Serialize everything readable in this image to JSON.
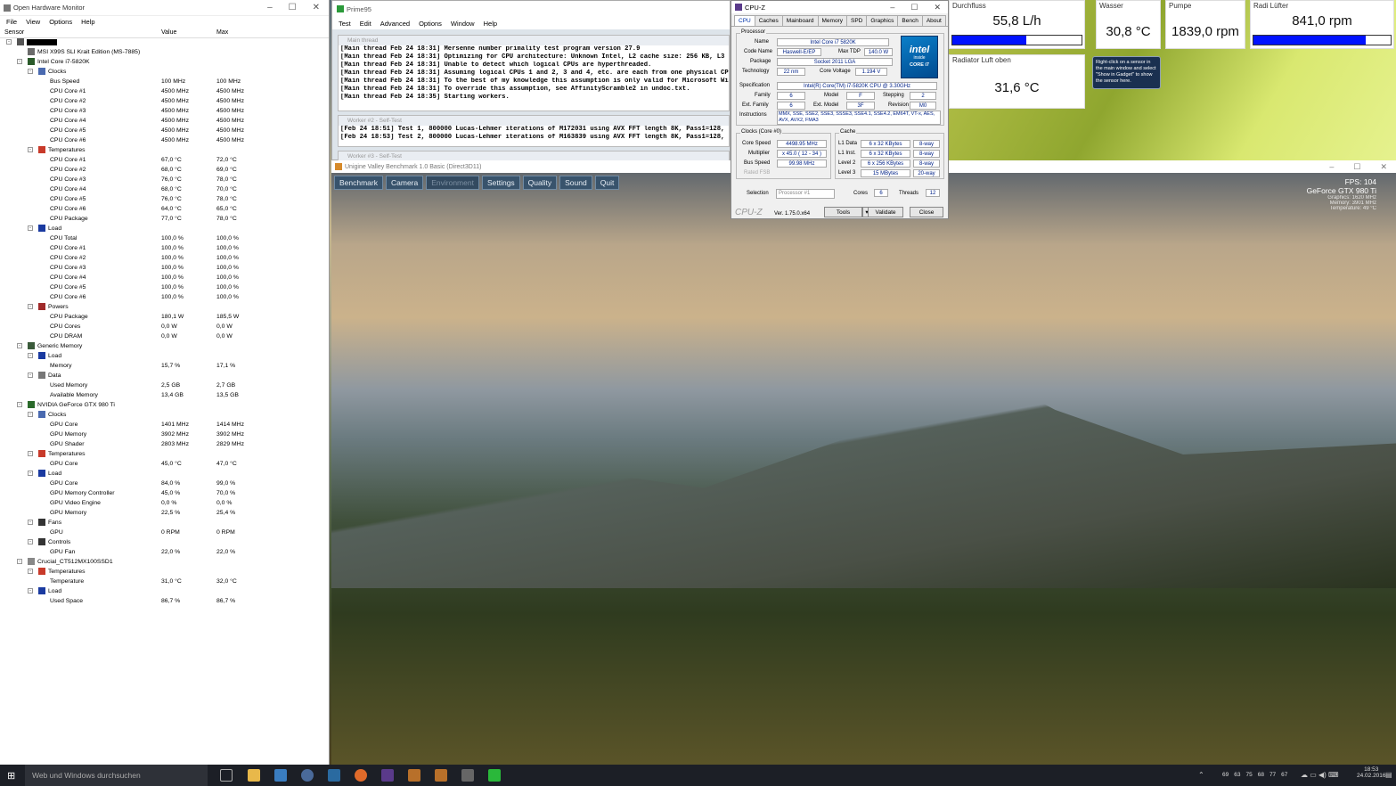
{
  "ohm": {
    "title": "Open Hardware Monitor",
    "menu": [
      "File",
      "View",
      "Options",
      "Help"
    ],
    "columns": [
      "Sensor",
      "Value",
      "Max"
    ],
    "rows": [
      {
        "level": 0,
        "name": "",
        "value": "",
        "max": "",
        "icon": "computer",
        "exp": "-",
        "redacted": true
      },
      {
        "level": 1,
        "name": "MSI X99S SLI Krait Edition (MS-7885)",
        "value": "",
        "max": "",
        "icon": "board"
      },
      {
        "level": 1,
        "name": "Intel Core i7-5820K",
        "value": "",
        "max": "",
        "icon": "cpu",
        "exp": "-"
      },
      {
        "level": 2,
        "name": "Clocks",
        "value": "",
        "max": "",
        "icon": "clock",
        "exp": "-"
      },
      {
        "level": 3,
        "name": "Bus Speed",
        "value": "100 MHz",
        "max": "100 MHz"
      },
      {
        "level": 3,
        "name": "CPU Core #1",
        "value": "4500 MHz",
        "max": "4500 MHz"
      },
      {
        "level": 3,
        "name": "CPU Core #2",
        "value": "4500 MHz",
        "max": "4500 MHz"
      },
      {
        "level": 3,
        "name": "CPU Core #3",
        "value": "4500 MHz",
        "max": "4500 MHz"
      },
      {
        "level": 3,
        "name": "CPU Core #4",
        "value": "4500 MHz",
        "max": "4500 MHz"
      },
      {
        "level": 3,
        "name": "CPU Core #5",
        "value": "4500 MHz",
        "max": "4500 MHz"
      },
      {
        "level": 3,
        "name": "CPU Core #6",
        "value": "4500 MHz",
        "max": "4500 MHz"
      },
      {
        "level": 2,
        "name": "Temperatures",
        "value": "",
        "max": "",
        "icon": "temp",
        "exp": "-"
      },
      {
        "level": 3,
        "name": "CPU Core #1",
        "value": "67,0 °C",
        "max": "72,0 °C"
      },
      {
        "level": 3,
        "name": "CPU Core #2",
        "value": "68,0 °C",
        "max": "69,0 °C"
      },
      {
        "level": 3,
        "name": "CPU Core #3",
        "value": "76,0 °C",
        "max": "78,0 °C"
      },
      {
        "level": 3,
        "name": "CPU Core #4",
        "value": "68,0 °C",
        "max": "70,0 °C"
      },
      {
        "level": 3,
        "name": "CPU Core #5",
        "value": "76,0 °C",
        "max": "78,0 °C"
      },
      {
        "level": 3,
        "name": "CPU Core #6",
        "value": "64,0 °C",
        "max": "65,0 °C"
      },
      {
        "level": 3,
        "name": "CPU Package",
        "value": "77,0 °C",
        "max": "78,0 °C"
      },
      {
        "level": 2,
        "name": "Load",
        "value": "",
        "max": "",
        "icon": "load",
        "exp": "-"
      },
      {
        "level": 3,
        "name": "CPU Total",
        "value": "100,0 %",
        "max": "100,0 %"
      },
      {
        "level": 3,
        "name": "CPU Core #1",
        "value": "100,0 %",
        "max": "100,0 %"
      },
      {
        "level": 3,
        "name": "CPU Core #2",
        "value": "100,0 %",
        "max": "100,0 %"
      },
      {
        "level": 3,
        "name": "CPU Core #3",
        "value": "100,0 %",
        "max": "100,0 %"
      },
      {
        "level": 3,
        "name": "CPU Core #4",
        "value": "100,0 %",
        "max": "100,0 %"
      },
      {
        "level": 3,
        "name": "CPU Core #5",
        "value": "100,0 %",
        "max": "100,0 %"
      },
      {
        "level": 3,
        "name": "CPU Core #6",
        "value": "100,0 %",
        "max": "100,0 %"
      },
      {
        "level": 2,
        "name": "Powers",
        "value": "",
        "max": "",
        "icon": "power",
        "exp": "-"
      },
      {
        "level": 3,
        "name": "CPU Package",
        "value": "180,1 W",
        "max": "185,5 W"
      },
      {
        "level": 3,
        "name": "CPU Cores",
        "value": "0,0 W",
        "max": "0,0 W"
      },
      {
        "level": 3,
        "name": "CPU DRAM",
        "value": "0,0 W",
        "max": "0,0 W"
      },
      {
        "level": 1,
        "name": "Generic Memory",
        "value": "",
        "max": "",
        "icon": "ram",
        "exp": "-"
      },
      {
        "level": 2,
        "name": "Load",
        "value": "",
        "max": "",
        "icon": "load",
        "exp": "-"
      },
      {
        "level": 3,
        "name": "Memory",
        "value": "15,7 %",
        "max": "17,1 %"
      },
      {
        "level": 2,
        "name": "Data",
        "value": "",
        "max": "",
        "icon": "data",
        "exp": "-"
      },
      {
        "level": 3,
        "name": "Used Memory",
        "value": "2,5 GB",
        "max": "2,7 GB"
      },
      {
        "level": 3,
        "name": "Available Memory",
        "value": "13,4 GB",
        "max": "13,5 GB"
      },
      {
        "level": 1,
        "name": "NVIDIA GeForce GTX 980 Ti",
        "value": "",
        "max": "",
        "icon": "gpu",
        "exp": "-"
      },
      {
        "level": 2,
        "name": "Clocks",
        "value": "",
        "max": "",
        "icon": "clock",
        "exp": "-"
      },
      {
        "level": 3,
        "name": "GPU Core",
        "value": "1401 MHz",
        "max": "1414 MHz"
      },
      {
        "level": 3,
        "name": "GPU Memory",
        "value": "3902 MHz",
        "max": "3902 MHz"
      },
      {
        "level": 3,
        "name": "GPU Shader",
        "value": "2803 MHz",
        "max": "2829 MHz"
      },
      {
        "level": 2,
        "name": "Temperatures",
        "value": "",
        "max": "",
        "icon": "temp",
        "exp": "-"
      },
      {
        "level": 3,
        "name": "GPU Core",
        "value": "45,0 °C",
        "max": "47,0 °C"
      },
      {
        "level": 2,
        "name": "Load",
        "value": "",
        "max": "",
        "icon": "load",
        "exp": "-"
      },
      {
        "level": 3,
        "name": "GPU Core",
        "value": "84,0 %",
        "max": "99,0 %"
      },
      {
        "level": 3,
        "name": "GPU Memory Controller",
        "value": "45,0 %",
        "max": "70,0 %"
      },
      {
        "level": 3,
        "name": "GPU Video Engine",
        "value": "0,0 %",
        "max": "0,0 %"
      },
      {
        "level": 3,
        "name": "GPU Memory",
        "value": "22,5 %",
        "max": "25,4 %"
      },
      {
        "level": 2,
        "name": "Fans",
        "value": "",
        "max": "",
        "icon": "fan",
        "exp": "-"
      },
      {
        "level": 3,
        "name": "GPU",
        "value": "0 RPM",
        "max": "0 RPM"
      },
      {
        "level": 2,
        "name": "Controls",
        "value": "",
        "max": "",
        "icon": "control",
        "exp": "-"
      },
      {
        "level": 3,
        "name": "GPU Fan",
        "value": "22,0 %",
        "max": "22,0 %"
      },
      {
        "level": 1,
        "name": "Crucial_CT512MX100SSD1",
        "value": "",
        "max": "",
        "icon": "disk",
        "exp": "-"
      },
      {
        "level": 2,
        "name": "Temperatures",
        "value": "",
        "max": "",
        "icon": "temp",
        "exp": "-"
      },
      {
        "level": 3,
        "name": "Temperature",
        "value": "31,0 °C",
        "max": "32,0 °C"
      },
      {
        "level": 2,
        "name": "Load",
        "value": "",
        "max": "",
        "icon": "load",
        "exp": "-"
      },
      {
        "level": 3,
        "name": "Used Space",
        "value": "86,7 %",
        "max": "86,7 %"
      }
    ]
  },
  "prime95": {
    "title": "Prime95",
    "menu": [
      "Test",
      "Edit",
      "Advanced",
      "Options",
      "Window",
      "Help"
    ],
    "main_title": "Main thread",
    "main_lines": [
      "[Main thread Feb 24 18:31] Mersenne number primality test program version 27.9",
      "[Main thread Feb 24 18:31] Optimizing for CPU architecture: Unknown Intel, L2 cache size: 256 KB, L3 cache siz",
      "[Main thread Feb 24 18:31] Unable to detect which logical CPUs are hyperthreaded.",
      "[Main thread Feb 24 18:31] Assuming logical CPUs 1 and 2, 3 and 4, etc. are each from one physical CPU core.",
      "[Main thread Feb 24 18:31] To the best of my knowledge this assumption is only valid for Microsoft Windows.",
      "[Main thread Feb 24 18:31] To override this assumption, see AffinityScramble2 in undoc.txt.",
      "[Main thread Feb 24 18:35] Starting workers."
    ],
    "worker_title": "Worker #2 - Self-Test",
    "worker_lines": [
      "[Feb 24 18:51] Test 1, 800000 Lucas-Lehmer iterations of M172031 using AVX FFT length 8K, Pass1=128, Pass",
      "[Feb 24 18:53] Test 2, 800000 Lucas-Lehmer iterations of M163839 using AVX FFT length 8K, Pass1=128, Pass"
    ],
    "worker3_title": "Worker #3 - Self-Test"
  },
  "cpuz": {
    "title": "CPU-Z",
    "tabs": [
      "CPU",
      "Caches",
      "Mainboard",
      "Memory",
      "SPD",
      "Graphics",
      "Bench",
      "About"
    ],
    "processor_label": "Processor",
    "name_label": "Name",
    "name": "Intel Core i7 5820K",
    "codename_label": "Code Name",
    "codename": "Haswell-E/EP",
    "maxtdp_label": "Max TDP",
    "maxtdp": "140.0 W",
    "package_label": "Package",
    "package": "Socket 2011 LGA",
    "tech_label": "Technology",
    "tech": "22 nm",
    "voltage_label": "Core Voltage",
    "voltage": "1.194 V",
    "spec_label": "Specification",
    "spec": "Intel(R) Core(TM) i7-5820K CPU @ 3.30GHz",
    "family_label": "Family",
    "family": "6",
    "model_label": "Model",
    "model": "F",
    "stepping_label": "Stepping",
    "stepping": "2",
    "extfamily_label": "Ext. Family",
    "extfamily": "6",
    "extmodel_label": "Ext. Model",
    "extmodel": "3F",
    "revision_label": "Revision",
    "revision": "M0",
    "instr_label": "Instructions",
    "instr": "MMX, SSE, SSE2, SSE3, SSSE3, SSE4.1, SSE4.2, EM64T, VT-x, AES, AVX, AVX2, FMA3",
    "clocks_label": "Clocks (Core #0)",
    "corespeed_label": "Core Speed",
    "corespeed": "4498.95 MHz",
    "mult_label": "Multiplier",
    "mult": "x 45.0 ( 12 - 34 )",
    "bus_label": "Bus Speed",
    "bus": "99.98 MHz",
    "fsb_label": "Rated FSB",
    "cache_label": "Cache",
    "l1d_label": "L1 Data",
    "l1d": "6 x 32 KBytes",
    "l1d_way": "8-way",
    "l1i_label": "L1 Inst.",
    "l1i": "6 x 32 KBytes",
    "l1i_way": "8-way",
    "l2_label": "Level 2",
    "l2": "6 x 256 KBytes",
    "l2_way": "8-way",
    "l3_label": "Level 3",
    "l3": "15 MBytes",
    "l3_way": "20-way",
    "selection_label": "Selection",
    "selection": "Processor #1",
    "cores_label": "Cores",
    "cores": "6",
    "threads_label": "Threads",
    "threads": "12",
    "brand": "CPU-Z",
    "version": "Ver. 1.75.0.x64",
    "tools_button": "Tools",
    "validate_button": "Validate",
    "close_button": "Close",
    "intel_logo_1": "intel",
    "intel_logo_2": "inside",
    "intel_logo_3": "CORE i7"
  },
  "gadgets": [
    {
      "label": "Durchfluss",
      "value": "55,8 L/h",
      "bar": 0.57
    },
    {
      "label": "Wasser",
      "value": "30,8 °C"
    },
    {
      "label": "Pumpe",
      "value": "1839,0 rpm"
    },
    {
      "label": "Radi Lüfter",
      "value": "841,0 rpm",
      "bar": 0.82
    },
    {
      "label": "Radiator Luft oben",
      "value": "31,6 °C"
    }
  ],
  "tooltip": "Right-click on a sensor in the main window and select \"Show in Gadget\" to show the sensor here.",
  "valley": {
    "title": "Unigine Valley Benchmark 1.0 Basic (Direct3D11)",
    "menu": [
      "Benchmark",
      "Camera",
      "Environment",
      "Settings",
      "Quality",
      "Sound",
      "Quit"
    ],
    "fps": "FPS: 104",
    "gpu": "GeForce GTX 980 Ti",
    "graphics": "Graphics: 1620 MHz",
    "memory": "Memory: 3901 MHz",
    "temp": "Temperature: 49 °C"
  },
  "taskbar": {
    "search": "Web und Windows durchsuchen",
    "time": "18:53",
    "date": "24.02.2016",
    "tray_nums": [
      "69",
      "63",
      "75",
      "68",
      "77",
      "67"
    ]
  },
  "colors": {
    "gadget_bar": "#0012ff",
    "valley_button": "#38536c"
  }
}
